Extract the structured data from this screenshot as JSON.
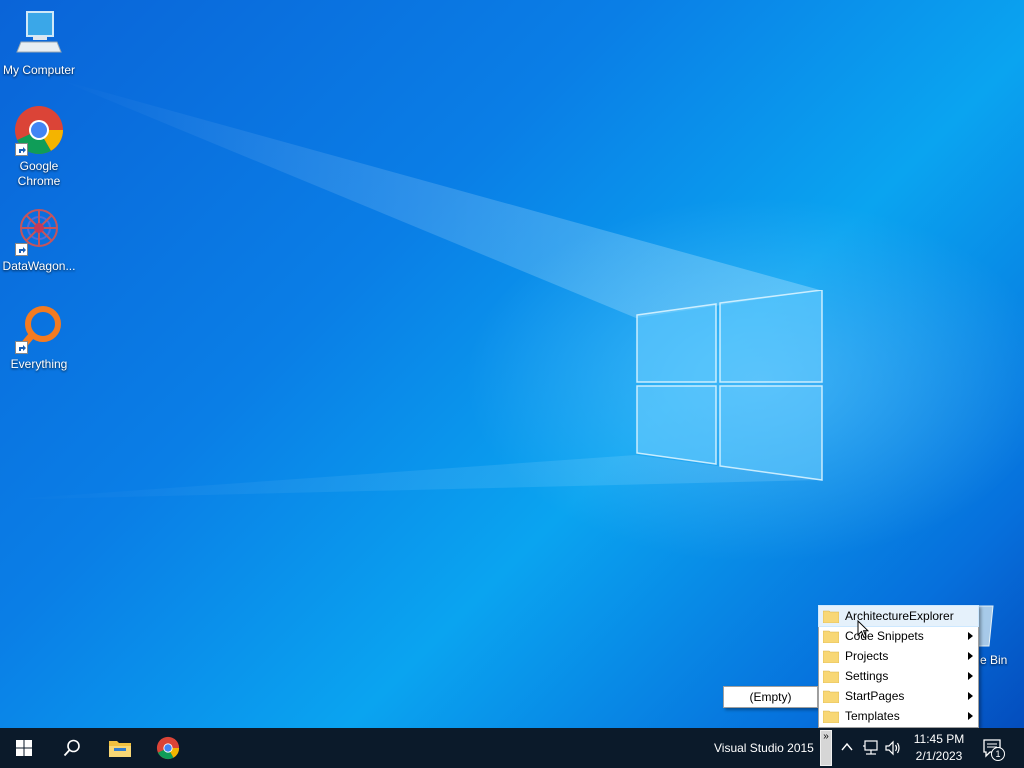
{
  "desktop": {
    "icons": [
      {
        "label": "My Computer",
        "icon": "computer-icon"
      },
      {
        "label": "Google Chrome",
        "icon": "chrome-icon"
      },
      {
        "label": "DataWagon...",
        "icon": "datawagon-icon"
      },
      {
        "label": "Everything",
        "icon": "everything-search-icon"
      }
    ],
    "recycle_bin_label": "e Bin"
  },
  "menu": {
    "items": [
      {
        "label": "ArchitectureExplorer",
        "has_submenu": false,
        "highlighted": true
      },
      {
        "label": "Code Snippets",
        "has_submenu": true
      },
      {
        "label": "Projects",
        "has_submenu": true
      },
      {
        "label": "Settings",
        "has_submenu": true
      },
      {
        "label": "StartPages",
        "has_submenu": true
      },
      {
        "label": "Templates",
        "has_submenu": true
      }
    ],
    "submenu_label": "(Empty)"
  },
  "taskbar": {
    "toolbar_label": "Visual Studio 2015",
    "chevron": "»",
    "clock_time": "11:45 PM",
    "clock_date": "2/1/2023",
    "notification_count": "1",
    "pinned": [
      "start-icon",
      "search-icon",
      "file-explorer-icon",
      "chrome-icon"
    ]
  },
  "colors": {
    "taskbar": "#0b1a2a",
    "desktop_accent": "#0a7ee6",
    "menu_highlight": "#e5f1fb",
    "folder": "#f8d775"
  }
}
